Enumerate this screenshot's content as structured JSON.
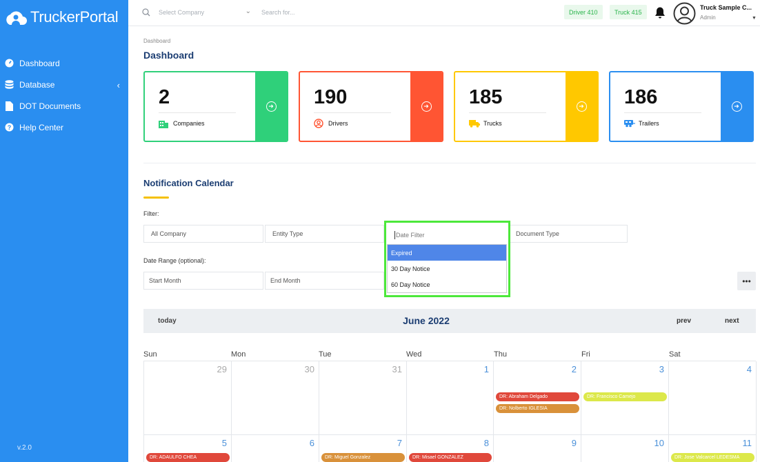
{
  "sidebar": {
    "brand": "TruckerPortal",
    "items": [
      {
        "label": "Dashboard"
      },
      {
        "label": "Database"
      },
      {
        "label": "DOT Documents"
      },
      {
        "label": "Help Center"
      }
    ],
    "version": "v.2.0",
    "color": "#2a8ef0"
  },
  "topbar": {
    "select_company_placeholder": "Select Company",
    "search_placeholder": "Search for...",
    "driver_chip": "Driver 410",
    "truck_chip": "Truck 415",
    "user_name": "Truck Sample C...",
    "user_role": "Admin"
  },
  "page": {
    "breadcrumb": "Dashboard",
    "title": "Dashboard"
  },
  "cards": [
    {
      "value": "2",
      "label": "Companies",
      "color": "#2fd07a",
      "icon": "building-icon"
    },
    {
      "value": "190",
      "label": "Drivers",
      "color": "#ff5533",
      "icon": "user-circle-icon"
    },
    {
      "value": "185",
      "label": "Trucks",
      "color": "#ffc800",
      "icon": "truck-icon"
    },
    {
      "value": "186",
      "label": "Trailers",
      "color": "#2a8ef0",
      "icon": "trailer-icon"
    }
  ],
  "calendar_section": {
    "title": "Notification Calendar",
    "filter_label": "Filter:",
    "all_company": "All Company",
    "entity_type": "Entity Type",
    "date_filter": "Date Filter",
    "document_type": "Document Type",
    "date_range_label": "Date Range (optional):",
    "start_month": "Start Month",
    "end_month": "End Month",
    "date_filter_options": [
      "Expired",
      "30 Day Notice",
      "60 Day Notice"
    ],
    "selected_option": "Expired"
  },
  "calendar": {
    "today": "today",
    "month": "June 2022",
    "prev": "prev",
    "next": "next",
    "weekdays": [
      "Sun",
      "Mon",
      "Tue",
      "Wed",
      "Thu",
      "Fri",
      "Sat"
    ],
    "week1": [
      "29",
      "30",
      "31",
      "1",
      "2",
      "3",
      "4"
    ],
    "week2": [
      "5",
      "6",
      "7",
      "8",
      "9",
      "10",
      "11"
    ],
    "events": {
      "thu2_a": "DR: Abraham Delgado",
      "thu2_b": "DR: Nolberto IGLESIA",
      "fri3_a": "DR: Francisco Camejo",
      "sun5_a": "DR: ADAULFO CHEA",
      "tue7_a": "DR: Miguel Gonzalez",
      "wed8_a": "DR: Misael GONZALEZ",
      "sat11_a": "DR: Jose Valcarcel LEDESMA"
    },
    "event_colors": {
      "red": "#e0483b",
      "orange": "#d9913a",
      "yellow": "#dce84a"
    }
  }
}
